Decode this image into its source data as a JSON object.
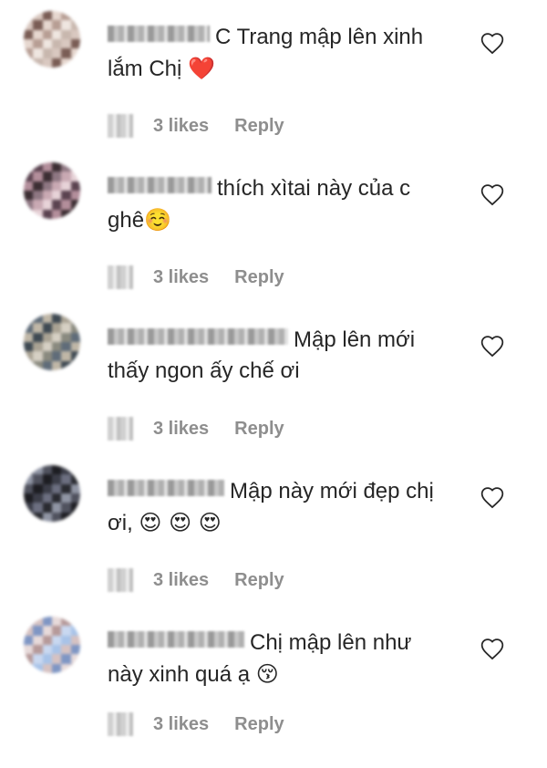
{
  "comments": [
    {
      "text_line1": "C Trang mập lên xinh",
      "text_line2": "lắm Chị",
      "emoji": "❤️",
      "likes": "3 likes",
      "reply": "Reply",
      "avatar_colors": [
        "#c8b7ae",
        "#d9c8c0",
        "#7a5d55",
        "#e6d7cf",
        "#b79e94",
        "#efe6e0"
      ]
    },
    {
      "text_line1": "thích xìtai này của c",
      "text_line2": "ghê",
      "emoji": "☺️",
      "likes": "3 likes",
      "reply": "Reply",
      "avatar_colors": [
        "#3c2e33",
        "#8e7782",
        "#c9a9b3",
        "#e7d3d8",
        "#5b4350",
        "#b38e9b"
      ]
    },
    {
      "text_line1": "Mập lên mới",
      "text_line2": "thấy ngon ấy chế ơi",
      "emoji": "",
      "likes": "3 likes",
      "reply": "Reply",
      "avatar_colors": [
        "#8a8a7f",
        "#5f6c79",
        "#c0b7a7",
        "#3f4a53",
        "#a9a293",
        "#d6d0c4"
      ]
    },
    {
      "text_line1": "Mập này mới đẹp chị",
      "text_line2": "ơi,",
      "emoji": "😍 😍 😍",
      "likes": "3 likes",
      "reply": "Reply",
      "avatar_colors": [
        "#1d1d22",
        "#3b3d48",
        "#6c6f80",
        "#2a2b31",
        "#9095a4",
        "#50525e"
      ]
    },
    {
      "text_line1": "Chị mập lên như",
      "text_line2": "này xinh quá ạ",
      "emoji": "😚",
      "likes": "3 likes",
      "reply": "Reply",
      "avatar_colors": [
        "#a8c3e8",
        "#d6c2c2",
        "#7f96c4",
        "#e7dada",
        "#b69a9a",
        "#c9d8f0"
      ]
    }
  ]
}
